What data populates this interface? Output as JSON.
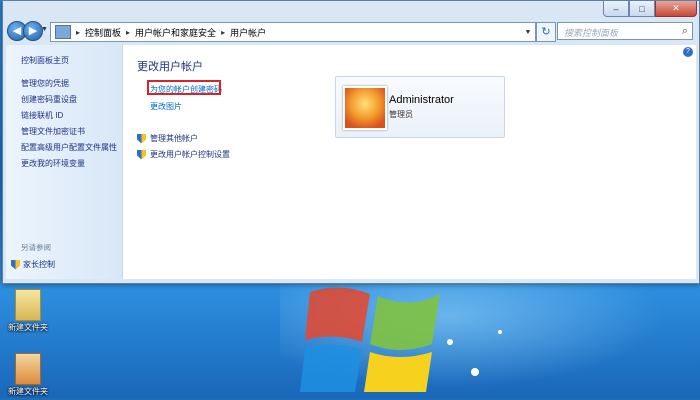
{
  "window": {
    "caption": {
      "minimize": "–",
      "maximize": "□",
      "close": "✕"
    }
  },
  "nav": {
    "back": "◀",
    "forward": "▶",
    "breadcrumb": [
      "控制面板",
      "用户帐户和家庭安全",
      "用户帐户"
    ],
    "refresh": "↻",
    "search_placeholder": "搜索控制面板"
  },
  "sidebar": {
    "home": "控制面板主页",
    "items": [
      "管理您的凭据",
      "创建密码重设盘",
      "链接联机 ID",
      "管理文件加密证书",
      "配置高级用户配置文件属性",
      "更改我的环境变量"
    ],
    "see_also": "另请参阅",
    "parental": "家长控制"
  },
  "main": {
    "title": "更改用户帐户",
    "create_password": "为您的帐户创建密码",
    "change_picture": "更改图片",
    "manage_other": "管理其他帐户",
    "uac_settings": "更改用户帐户控制设置"
  },
  "account": {
    "name": "Administrator",
    "role": "管理员"
  },
  "desktop": {
    "icons": [
      "新建文件夹",
      "新建文件夹"
    ]
  },
  "colors": {
    "highlight": "#d9232a",
    "link": "#1e3287"
  }
}
